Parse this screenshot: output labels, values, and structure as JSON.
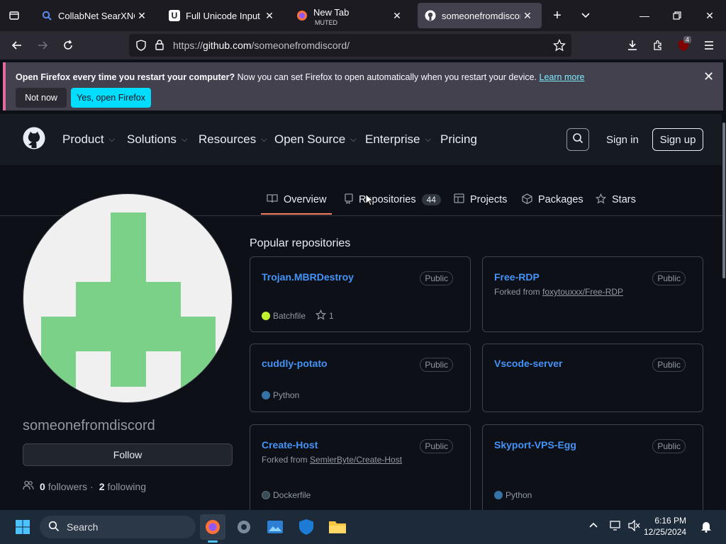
{
  "browser": {
    "tabs": [
      {
        "title": "CollabNet SearXNG",
        "favicon": "search-icon"
      },
      {
        "title": "Full Unicode Input utili",
        "favicon": "unicode-icon"
      },
      {
        "title": "New Tab",
        "subtitle": "MUTED",
        "favicon": "firefox-icon"
      },
      {
        "title": "someonefromdiscord",
        "favicon": "github-icon",
        "active": true
      }
    ],
    "url_prefix": "https://",
    "url_host": "github.com",
    "url_path": "/someonefromdiscord/",
    "extension_badge": "4"
  },
  "notification": {
    "bold": "Open Firefox every time you restart your computer?",
    "text": " Now you can set Firefox to open automatically when you restart your device. ",
    "link": "Learn more",
    "dismiss_label": "Not now",
    "accept_label": "Yes, open Firefox"
  },
  "github_header": {
    "nav": [
      "Product",
      "Solutions",
      "Resources",
      "Open Source",
      "Enterprise",
      "Pricing"
    ],
    "signin": "Sign in",
    "signup": "Sign up"
  },
  "profile_tabs": {
    "overview": "Overview",
    "repositories": "Repositories",
    "repo_count": "44",
    "projects": "Projects",
    "packages": "Packages",
    "stars": "Stars"
  },
  "profile": {
    "username": "someonefromdiscord",
    "follow_label": "Follow",
    "followers_count": "0",
    "followers_label": "followers",
    "separator": "·",
    "following_count": "2",
    "following_label": "following"
  },
  "popular": {
    "title": "Popular repositories",
    "repos": [
      {
        "name": "Trojan.MBRDestroy",
        "badge": "Public",
        "fork": "",
        "language": "Batchfile",
        "lang_color": "#c1f12e",
        "stars": "1"
      },
      {
        "name": "Free-RDP",
        "badge": "Public",
        "fork_prefix": "Forked from ",
        "fork": "foxytouxxx/Free-RDP",
        "language": "",
        "lang_color": "",
        "stars": ""
      },
      {
        "name": "cuddly-potato",
        "badge": "Public",
        "fork": "",
        "language": "Python",
        "lang_color": "#3572a5",
        "stars": ""
      },
      {
        "name": "Vscode-server",
        "badge": "Public",
        "fork": "",
        "language": "",
        "lang_color": "",
        "stars": ""
      },
      {
        "name": "Create-Host",
        "badge": "Public",
        "fork_prefix": "Forked from ",
        "fork": "SemlerByte/Create-Host",
        "language": "Dockerfile",
        "lang_color": "#384d54",
        "stars": ""
      },
      {
        "name": "Skyport-VPS-Egg",
        "badge": "Public",
        "fork": "",
        "language": "Python",
        "lang_color": "#3572a5",
        "stars": ""
      }
    ]
  },
  "taskbar": {
    "search_label": "Search",
    "time": "6:16 PM",
    "date": "12/25/2024"
  },
  "colors": {
    "accent_link": "#4493f8",
    "tab_underline": "#f78166",
    "avatar_green": "#7bd187",
    "firefox_accent": "#00ddff"
  }
}
